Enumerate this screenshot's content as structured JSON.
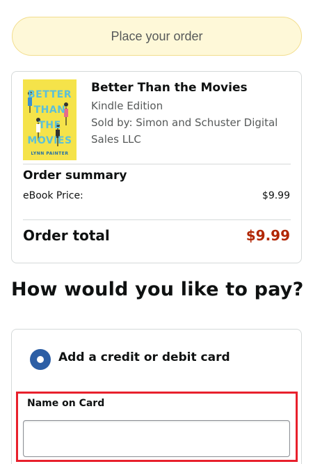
{
  "place_order": {
    "label": "Place your order"
  },
  "book": {
    "cover_lines": [
      "BETTER",
      "THAN",
      "THE",
      "MOVIES"
    ],
    "cover_author": "LYNN PAINTER",
    "title": "Better Than the Movies",
    "format": "Kindle Edition",
    "sold_by": "Sold by: Simon and Schuster Digital Sales LLC"
  },
  "order_summary": {
    "heading": "Order summary",
    "ebook_price_label": "eBook Price:",
    "ebook_price_value": "$9.99",
    "total_label": "Order total",
    "total_value": "$9.99"
  },
  "payment": {
    "heading": "How would you like to pay?",
    "option_label": "Add a credit or debit card",
    "name_on_card_label": "Name on Card",
    "name_on_card_value": ""
  },
  "colors": {
    "accent_total": "#b12704",
    "radio": "#2c5ea5",
    "highlight": "#e8202c",
    "place_order_bg": "#fef8d8"
  }
}
